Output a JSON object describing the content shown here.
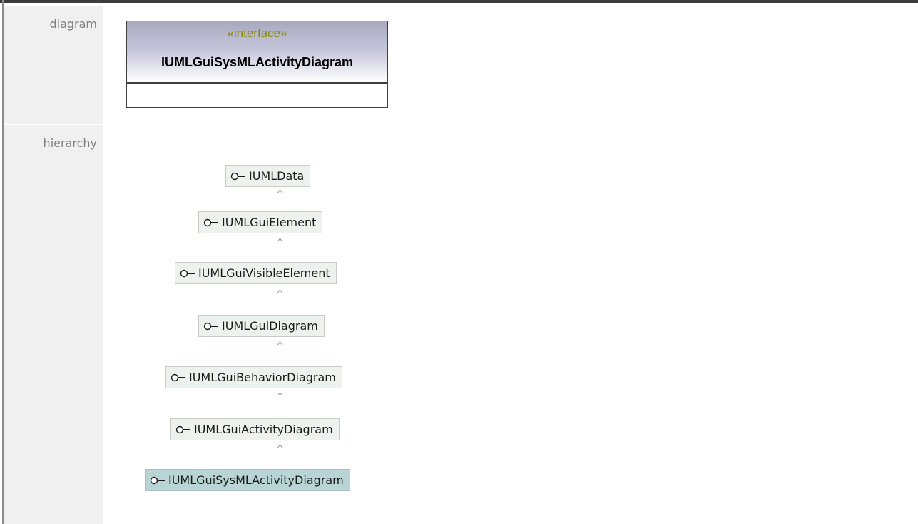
{
  "header": {
    "title": "IUMLGuiSysMLActivityDiagram"
  },
  "rows": [
    {
      "label": "diagram"
    },
    {
      "label": "hierarchy"
    }
  ],
  "diagram": {
    "stereotype": "«interface»",
    "name": "IUMLGuiSysMLActivityDiagram",
    "header_gradient": [
      "#a8a8c0",
      "#ffffff"
    ],
    "stereotype_color": "#8a8a00"
  },
  "hierarchy": {
    "icon": "interface-lollipop-icon",
    "nodes": [
      {
        "label": "IUMLData",
        "current": false
      },
      {
        "label": "IUMLGuiElement",
        "current": false
      },
      {
        "label": "IUMLGuiVisibleElement",
        "current": false
      },
      {
        "label": "IUMLGuiDiagram",
        "current": false
      },
      {
        "label": "IUMLGuiBehaviorDiagram",
        "current": false
      },
      {
        "label": "IUMLGuiActivityDiagram",
        "current": false
      },
      {
        "label": "IUMLGuiSysMLActivityDiagram",
        "current": true
      }
    ],
    "node_color": "#eef2ee",
    "current_color": "#b9d4d4"
  }
}
